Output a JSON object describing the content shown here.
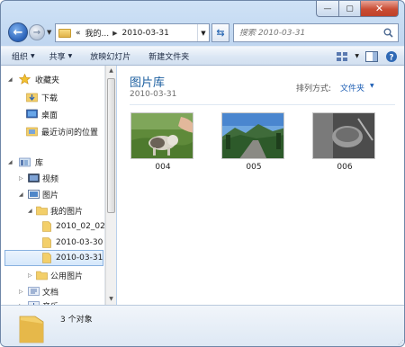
{
  "window": {
    "min_glyph": "—",
    "max_glyph": "▢",
    "close_glyph": "✕"
  },
  "navbar": {
    "address_prefix": "«",
    "address_parent": "我的...",
    "address_current": "2010-03-31",
    "search_placeholder": "搜索 2010-03-31"
  },
  "toolbar": {
    "organize": "组织",
    "share": "共享",
    "slideshow": "放映幻灯片",
    "new_folder": "新建文件夹"
  },
  "sidebar": {
    "favorites": "收藏夹",
    "downloads": "下载",
    "desktop": "桌面",
    "recent": "最近访问的位置",
    "libraries": "库",
    "videos": "视频",
    "pictures": "图片",
    "my_pictures": "我的图片",
    "folder_1": "2010_02_02",
    "folder_2": "2010-03-30",
    "folder_3": "2010-03-31",
    "public_pictures": "公用图片",
    "documents": "文档",
    "music": "音乐"
  },
  "content": {
    "library_title": "图片库",
    "library_subtitle": "2010-03-31",
    "arrange_label": "排列方式:",
    "arrange_value": "文件夹",
    "items": [
      {
        "label": "004"
      },
      {
        "label": "005"
      },
      {
        "label": "006"
      }
    ]
  },
  "status": {
    "count_text": "3 个对象"
  },
  "colors": {
    "accent": "#1b5e9f",
    "link": "#1e5fb5",
    "selection": "#d6e8fb",
    "close_button": "#c94c33"
  }
}
